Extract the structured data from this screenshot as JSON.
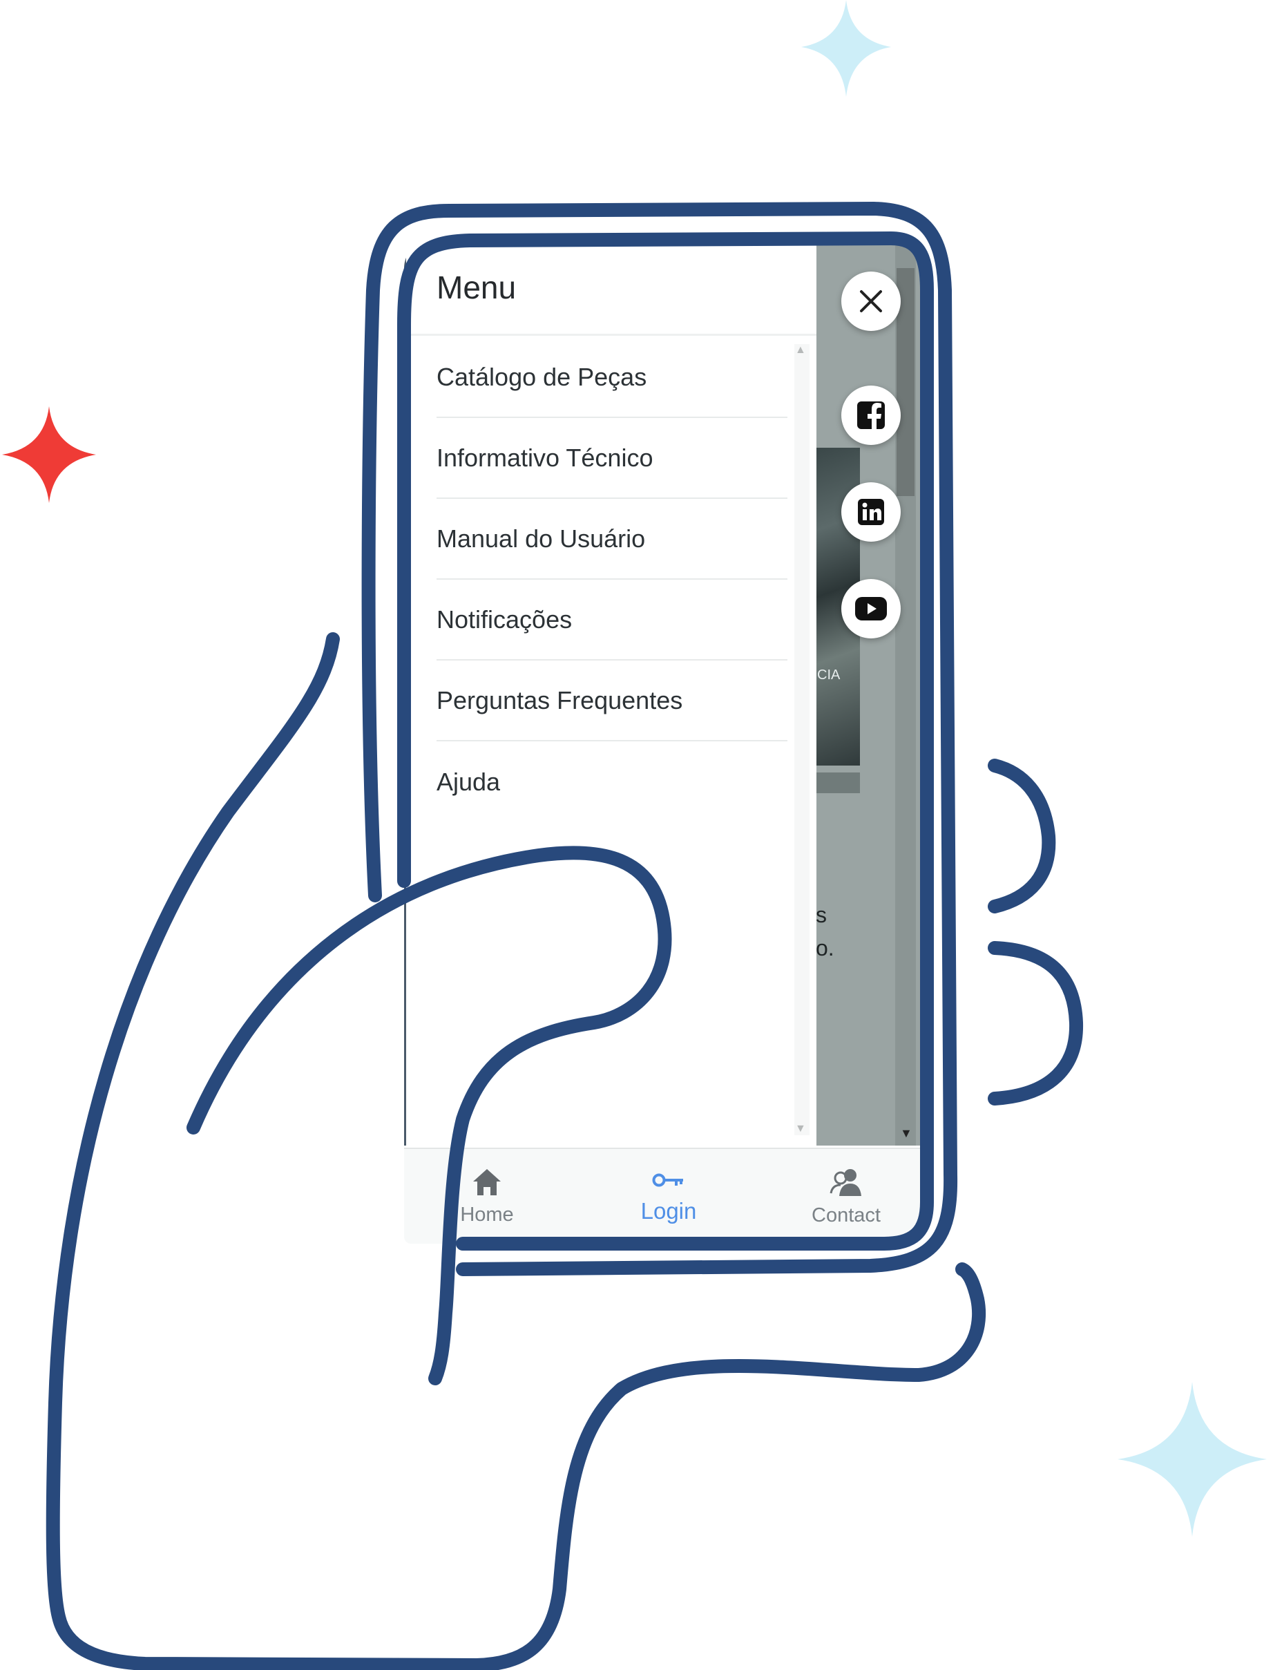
{
  "menu": {
    "title": "Menu",
    "items": [
      {
        "label": "Catálogo de Peças"
      },
      {
        "label": "Informativo Técnico"
      },
      {
        "label": "Manual do Usuário"
      },
      {
        "label": "Notificações"
      },
      {
        "label": "Perguntas Frequentes"
      },
      {
        "label": "Ajuda"
      }
    ]
  },
  "background_fragments": {
    "photo_caption": "CIA",
    "text_line_1": "s",
    "text_line_2": "o."
  },
  "bottom_nav": {
    "items": [
      {
        "label": "Home",
        "icon": "home-icon",
        "active": false
      },
      {
        "label": "Login",
        "icon": "key-icon",
        "active": true
      },
      {
        "label": "Contact",
        "icon": "contact-icon",
        "active": false
      }
    ]
  },
  "social": [
    "facebook-icon",
    "linkedin-icon",
    "youtube-icon"
  ],
  "colors": {
    "outline": "#28497c",
    "accent_active": "#4f8fe6",
    "nav_inactive": "#7a8186",
    "sparkle_red": "#ef3b36",
    "sparkle_light": "#cdeef8"
  }
}
